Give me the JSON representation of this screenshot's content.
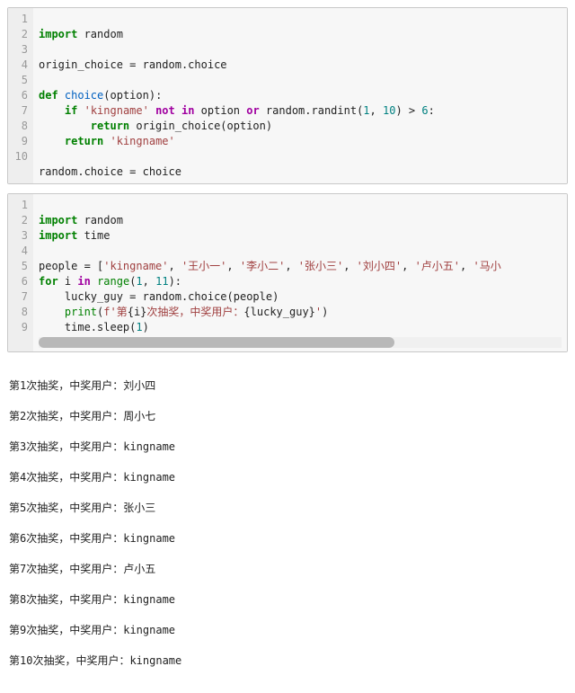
{
  "cell1": {
    "gutter": [
      "1",
      "2",
      "3",
      "4",
      "5",
      "6",
      "7",
      "8",
      "9",
      "10"
    ],
    "lines": {
      "l1_import": "import",
      "l1_random": " random",
      "l3_assign": "origin_choice = random.choice",
      "l5_def": "def",
      "l5_name": " choice",
      "l5_par": "(option):",
      "l6_if": "if",
      "l6_s1": " ",
      "l6_str": "'kingname'",
      "l6_s2": " ",
      "l6_not": "not",
      "l6_s3": " ",
      "l6_in": "in",
      "l6_s4": " option ",
      "l6_or": "or",
      "l6_s5": " random.randint(",
      "l6_n1": "1",
      "l6_c": ", ",
      "l6_n2": "10",
      "l6_s6": ") > ",
      "l6_n3": "6",
      "l6_col": ":",
      "l7_return": "return",
      "l7_rest": " origin_choice(option)",
      "l8_return": "return",
      "l8_s": " ",
      "l8_str": "'kingname'",
      "l10": "random.choice = choice"
    }
  },
  "cell2": {
    "gutter": [
      "1",
      "2",
      "3",
      "4",
      "5",
      "6",
      "7",
      "8",
      "9"
    ],
    "lines": {
      "l1_import": "import",
      "l1_random": " random",
      "l2_import": "import",
      "l2_time": " time",
      "l4_people": "people = [",
      "l4_s1": "'kingname'",
      "l4_c": ", ",
      "l4_s2": "'王小一'",
      "l4_s3": "'李小二'",
      "l4_s4": "'张小三'",
      "l4_s5": "'刘小四'",
      "l4_s6": "'卢小五'",
      "l4_s7": "'马小",
      "l5_for": "for",
      "l5_i": " i ",
      "l5_in": "in",
      "l5_s": " ",
      "l5_range": "range",
      "l5_par": "(",
      "l5_n1": "1",
      "l5_c": ", ",
      "l5_n2": "11",
      "l5_end": "):",
      "l6": "    lucky_guy = random.choice(people)",
      "l7_print": "print",
      "l7_op": "(",
      "l7_fpre": "f'第",
      "l7_e1": "{i}",
      "l7_mid": "次抽奖，中奖用户：",
      "l7_e2": "{lucky_guy}",
      "l7_fend": "'",
      "l7_cp": ")",
      "l8_sleep": "    time.sleep(",
      "l8_n": "1",
      "l8_cp": ")"
    }
  },
  "output_lines": [
    "第1次抽奖，中奖用户：刘小四",
    "第2次抽奖，中奖用户：周小七",
    "第3次抽奖，中奖用户：kingname",
    "第4次抽奖，中奖用户：kingname",
    "第5次抽奖，中奖用户：张小三",
    "第6次抽奖，中奖用户：kingname",
    "第7次抽奖，中奖用户：卢小五",
    "第8次抽奖，中奖用户：kingname",
    "第9次抽奖，中奖用户：kingname",
    "第10次抽奖，中奖用户：kingname"
  ]
}
